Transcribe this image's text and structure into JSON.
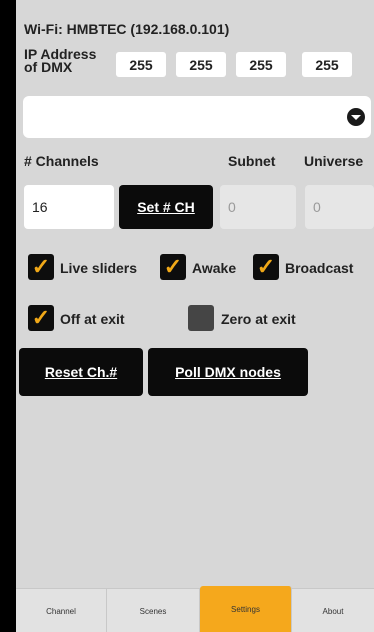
{
  "wifi": {
    "text": "Wi-Fi: HMBTEC (192.168.0.101)"
  },
  "ip": {
    "label_line1": "IP Address",
    "label_line2": "of DMX",
    "octets": [
      "255",
      "255",
      "255",
      "255"
    ]
  },
  "node_dropdown": {
    "value": "",
    "icon": "chevron-down-icon"
  },
  "channels": {
    "label": "# Channels",
    "value": "16",
    "set_button": "Set # CH"
  },
  "subnet": {
    "label": "Subnet",
    "value": "0"
  },
  "universe": {
    "label": "Universe",
    "value": "0"
  },
  "options": [
    {
      "label": "Live sliders",
      "checked": true
    },
    {
      "label": "Awake",
      "checked": true
    },
    {
      "label": "Broadcast",
      "checked": true
    },
    {
      "label": "Off at exit",
      "checked": true
    },
    {
      "label": "Zero at exit",
      "checked": false
    }
  ],
  "buttons": {
    "reset": "Reset Ch.#",
    "poll": "Poll DMX nodes"
  },
  "tabs": [
    {
      "label": "Channel",
      "active": false
    },
    {
      "label": "Scenes",
      "active": false
    },
    {
      "label": "Settings",
      "active": true
    },
    {
      "label": "About",
      "active": false
    }
  ],
  "colors": {
    "accent": "#f5a81c",
    "background": "#d7d7d7",
    "button": "#0b0b0b"
  }
}
